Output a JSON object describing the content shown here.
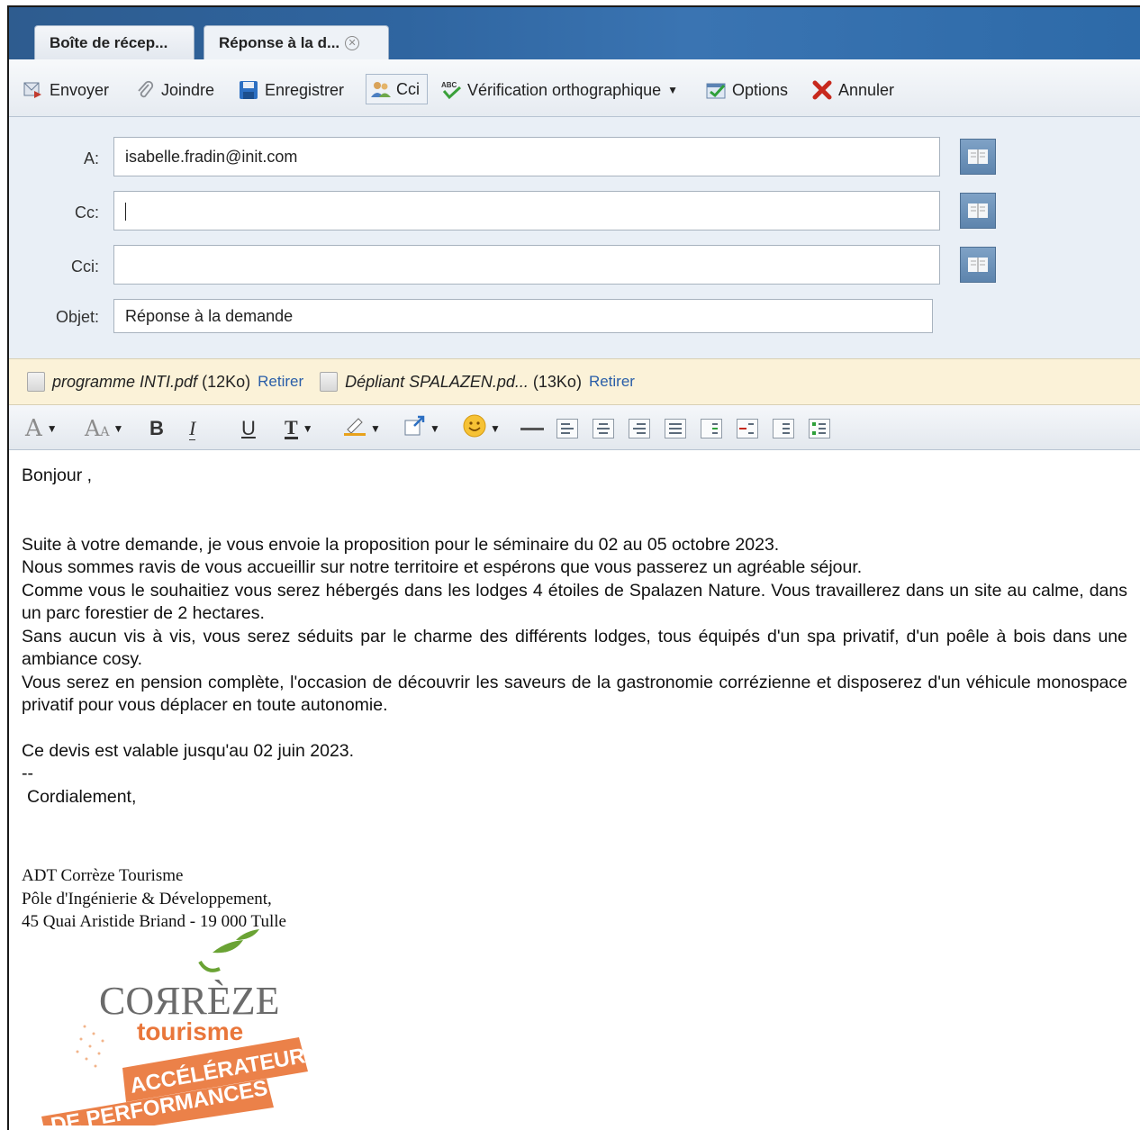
{
  "tabs": [
    {
      "label": "Boîte de récep..."
    },
    {
      "label": "Réponse à la d..."
    }
  ],
  "toolbar": {
    "send": "Envoyer",
    "attach": "Joindre",
    "save": "Enregistrer",
    "bcc": "Cci",
    "spellcheck": "Vérification orthographique",
    "options": "Options",
    "cancel": "Annuler"
  },
  "fields": {
    "to_label": "A:",
    "to_value": "isabelle.fradin@init.com",
    "cc_label": "Cc:",
    "cc_value": "",
    "bcc_label": "Cci:",
    "bcc_value": "",
    "subject_label": "Objet:",
    "subject_value": "Réponse à la demande"
  },
  "attachments": [
    {
      "name": "programme INTI.pdf",
      "size": "(12Ko)",
      "remove": "Retirer"
    },
    {
      "name": "Dépliant SPALAZEN.pd...",
      "size": "(13Ko)",
      "remove": "Retirer"
    }
  ],
  "message": {
    "greeting": "Bonjour ,",
    "paragraphs": [
      "Suite à votre demande, je vous envoie la proposition pour le séminaire du 02 au 05 octobre 2023.",
      "Nous sommes ravis de vous accueillir sur notre territoire et espérons que vous passerez un agréable séjour.",
      "Comme vous le souhaitiez vous serez hébergés dans les lodges 4 étoiles de Spalazen Nature. Vous travaillerez dans un site au calme, dans un parc forestier de 2 hectares.",
      "Sans aucun vis à vis, vous serez séduits par le charme des différents lodges, tous équipés d'un spa privatif, d'un poêle à bois dans une ambiance cosy.",
      "Vous serez en pension complète, l'occasion de découvrir les saveurs de la gastronomie corrézienne et disposerez d'un véhicule monospace privatif pour vous déplacer en toute autonomie."
    ],
    "validity": "Ce devis est valable jusqu'au 02 juin 2023.",
    "separator": "--",
    "closing": "Cordialement,"
  },
  "signature": {
    "line1": "ADT Corrèze Tourisme",
    "line2": "Pôle d'Ingénierie & Développement,",
    "line3": "45 Quai Aristide Briand - 19 000 Tulle"
  },
  "logo": {
    "word1": "COЯRÈZE",
    "word2": "tourisme",
    "banner1": "ACCÉLÉRATEUR",
    "banner2": "DE PERFORMANCES"
  },
  "colors": {
    "tab_bar": "#2f65a0",
    "header_bg": "#e9eff6",
    "attach_bg": "#fbf2d8",
    "link": "#2a5ea8",
    "logo_orange": "#e9763a",
    "logo_green": "#5a9a2e"
  }
}
